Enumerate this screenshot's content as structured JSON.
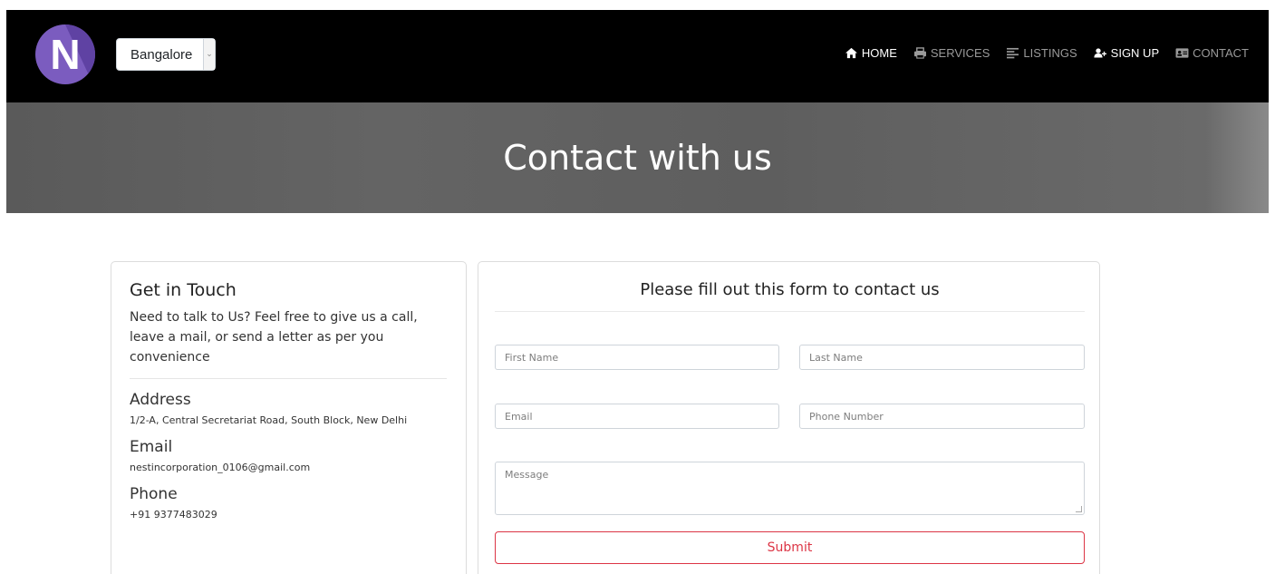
{
  "navbar": {
    "logo_letter": "N",
    "city_select": {
      "value": "Bangalore"
    },
    "links": [
      {
        "label": "HOME",
        "icon": "home-icon",
        "active": true
      },
      {
        "label": "SERVICES",
        "icon": "printer-icon",
        "active": false
      },
      {
        "label": "LISTINGS",
        "icon": "list-icon",
        "active": false
      },
      {
        "label": "SIGN UP",
        "icon": "user-plus-icon",
        "active": true
      },
      {
        "label": "CONTACT",
        "icon": "id-card-icon",
        "active": false
      }
    ]
  },
  "hero": {
    "title": "Contact with us"
  },
  "contact_info": {
    "title": "Get in Touch",
    "description": "Need to talk to Us? Feel free to give us a call, leave a mail, or send a letter as per you convenience",
    "address_label": "Address",
    "address_value": "1/2-A, Central Secretariat Road, South Block, New Delhi",
    "email_label": "Email",
    "email_value": "nestincorporation_0106@gmail.com",
    "phone_label": "Phone",
    "phone_value": "+91 9377483029"
  },
  "form": {
    "title": "Please fill out this form to contact us",
    "first_name_placeholder": "First Name",
    "last_name_placeholder": "Last Name",
    "email_placeholder": "Email",
    "phone_placeholder": "Phone Number",
    "message_placeholder": "Message",
    "submit_label": "Submit"
  },
  "colors": {
    "navbar_bg": "#000000",
    "submit_accent": "#dc3545",
    "logo_purple": "#7b5cbf"
  }
}
